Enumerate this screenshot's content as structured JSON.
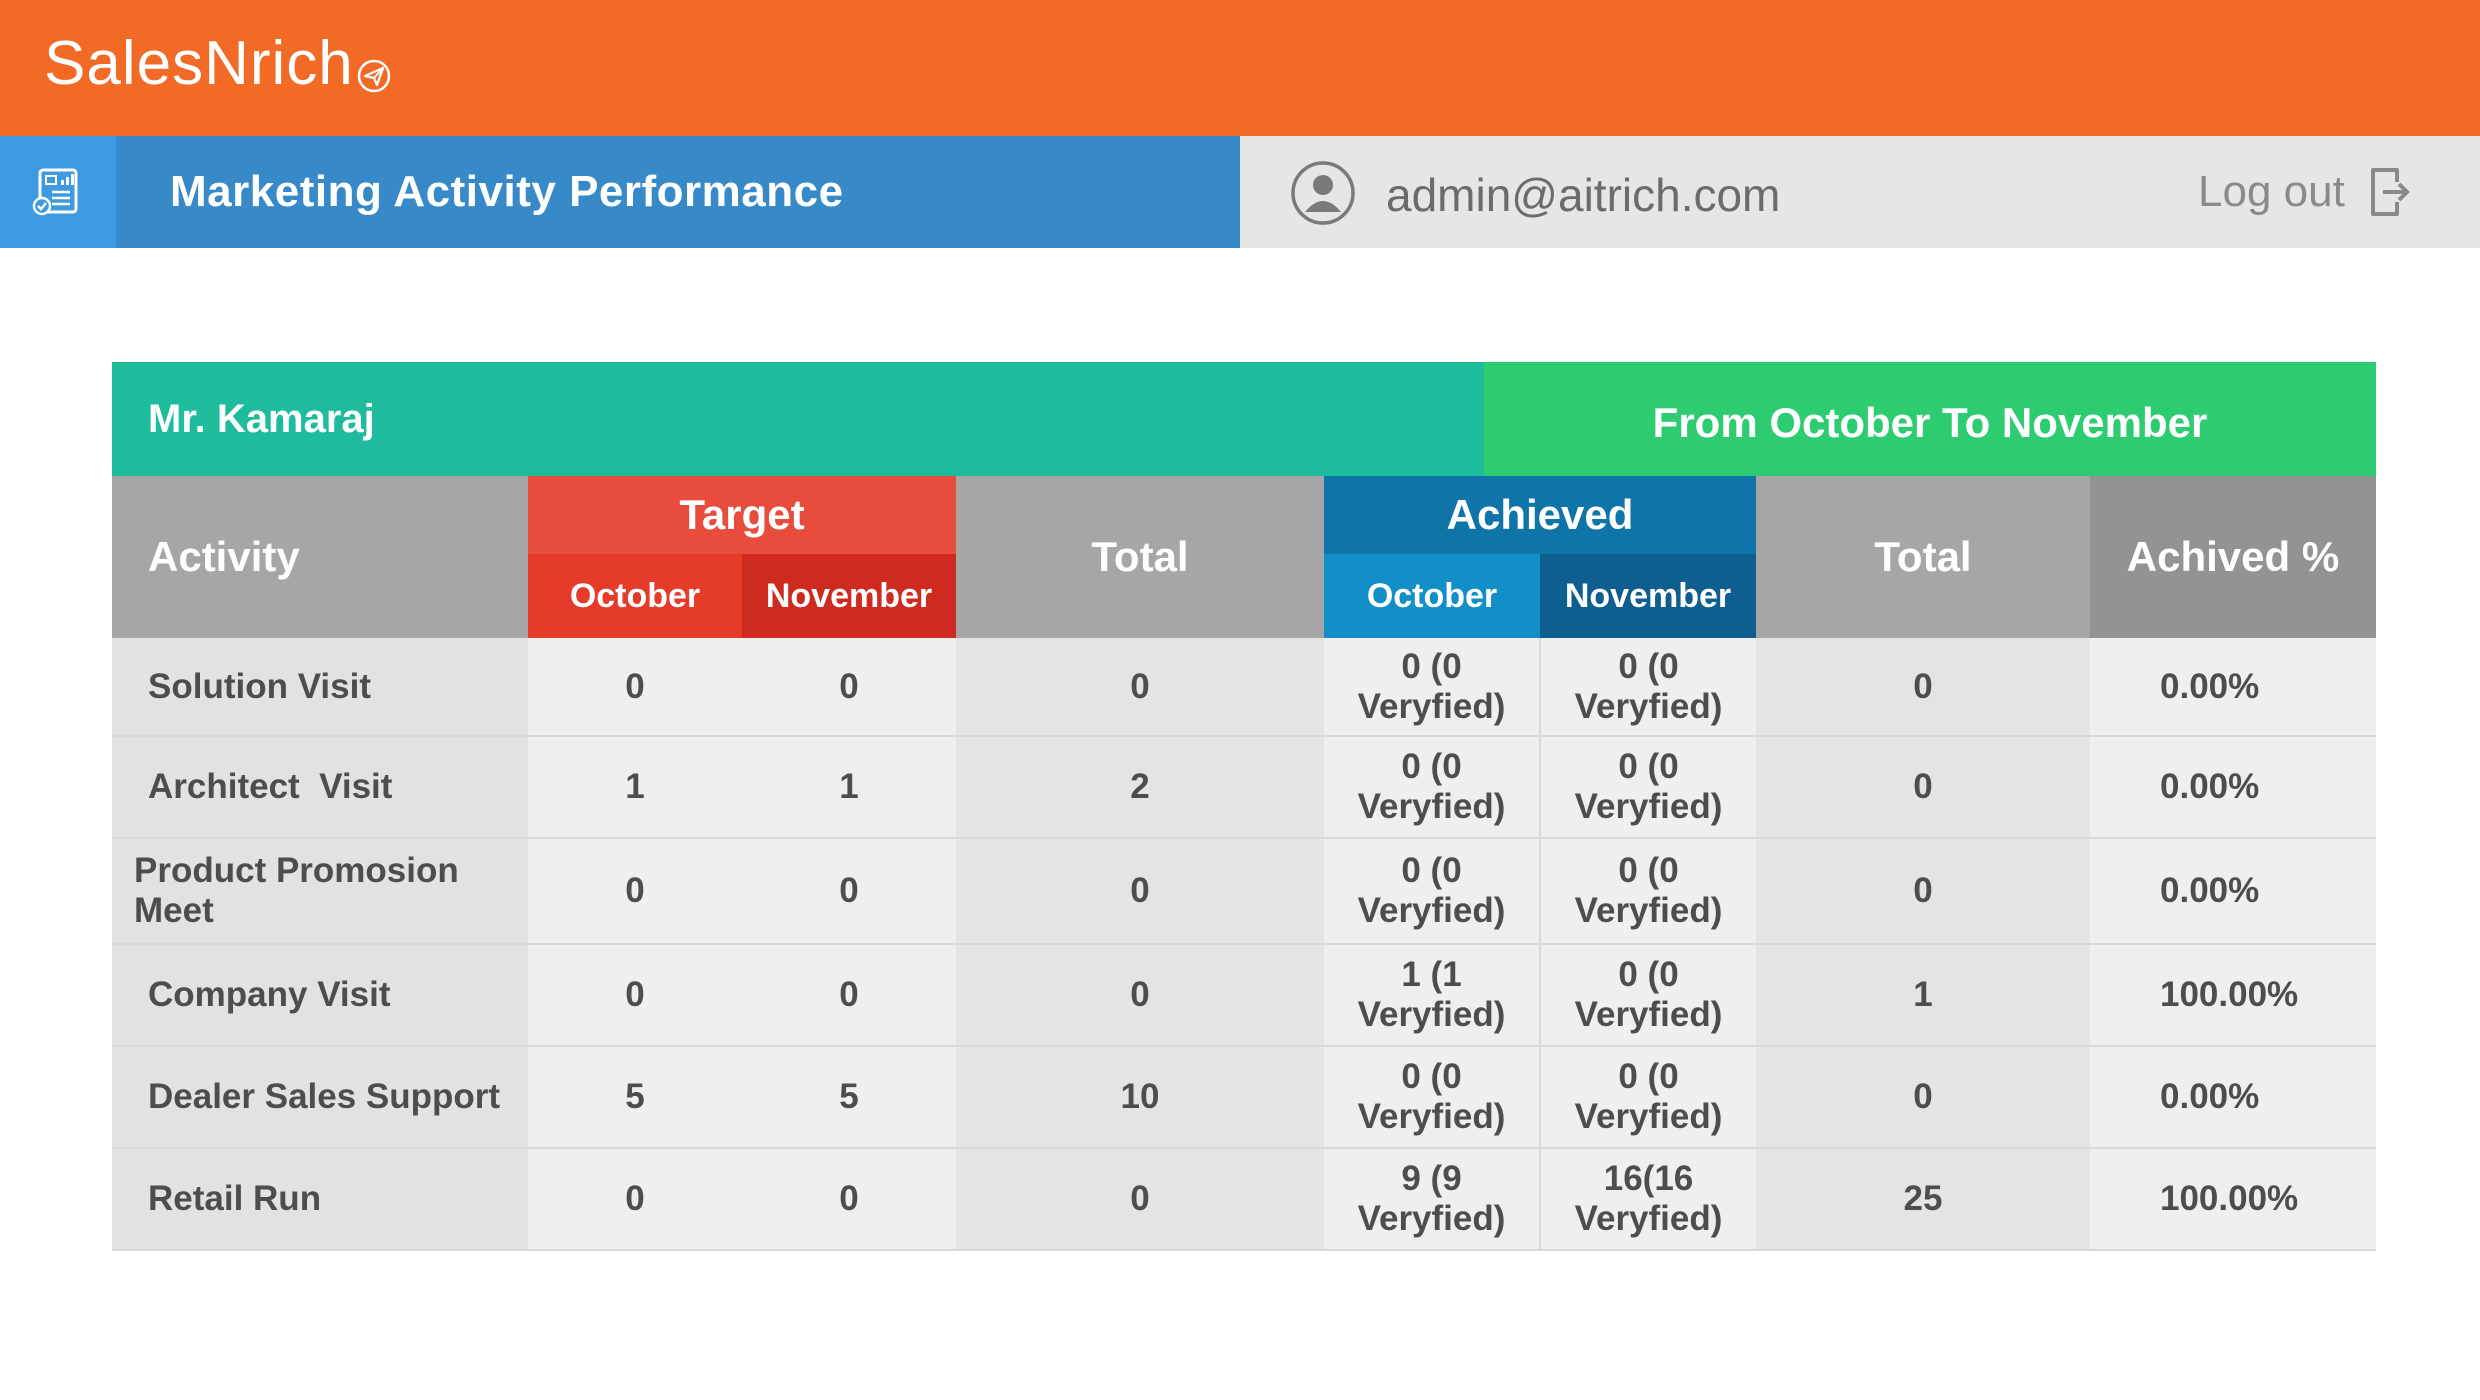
{
  "brand": {
    "name": "SalesNrich",
    "icon": "paper-plane-icon"
  },
  "header": {
    "title": "Marketing Activity Performance",
    "page_icon": "report-icon",
    "user_email": "admin@aitrich.com",
    "logout_label": "Log out"
  },
  "report": {
    "person": "Mr. Kamaraj",
    "period": "From October To November",
    "columns": {
      "activity": "Activity",
      "target": "Target",
      "target_month1": "October",
      "target_month2": "November",
      "total1": "Total",
      "achieved": "Achieved",
      "achieved_month1": "October",
      "achieved_month2": "November",
      "total2": "Total",
      "achieved_pct": "Achived %"
    },
    "rows": [
      {
        "activity": "Solution Visit",
        "t_oct": "0",
        "t_nov": "0",
        "t_total": "0",
        "a_oct": "0 (0 Veryfied)",
        "a_nov": "0 (0 Veryfied)",
        "a_total": "0",
        "pct": "0.00%"
      },
      {
        "activity": "Architect  Visit",
        "t_oct": "1",
        "t_nov": "1",
        "t_total": "2",
        "a_oct": "0 (0 Veryfied)",
        "a_nov": "0 (0 Veryfied)",
        "a_total": "0",
        "pct": "0.00%"
      },
      {
        "activity": "Product Promosion Meet",
        "t_oct": "0",
        "t_nov": "0",
        "t_total": "0",
        "a_oct": "0 (0 Veryfied)",
        "a_nov": "0 (0 Veryfied)",
        "a_total": "0",
        "pct": "0.00%"
      },
      {
        "activity": "Company Visit",
        "t_oct": "0",
        "t_nov": "0",
        "t_total": "0",
        "a_oct": "1 (1 Veryfied)",
        "a_nov": "0 (0 Veryfied)",
        "a_total": "1",
        "pct": "100.00%"
      },
      {
        "activity": "Dealer Sales Support",
        "t_oct": "5",
        "t_nov": "5",
        "t_total": "10",
        "a_oct": "0 (0 Veryfied)",
        "a_nov": "0 (0 Veryfied)",
        "a_total": "0",
        "pct": "0.00%"
      },
      {
        "activity": "Retail Run",
        "t_oct": "0",
        "t_nov": "0",
        "t_total": "0",
        "a_oct": "9 (9 Veryfied)",
        "a_nov": "16(16 Veryfied)",
        "a_total": "25",
        "pct": "100.00%"
      }
    ]
  },
  "colors": {
    "brand_orange": "#f26b26",
    "title_blue": "#3789c8",
    "person_teal": "#1ebc9c",
    "period_green": "#2ecc71",
    "target_red": "#e84c3d",
    "achieved_blue": "#0f74a7"
  }
}
